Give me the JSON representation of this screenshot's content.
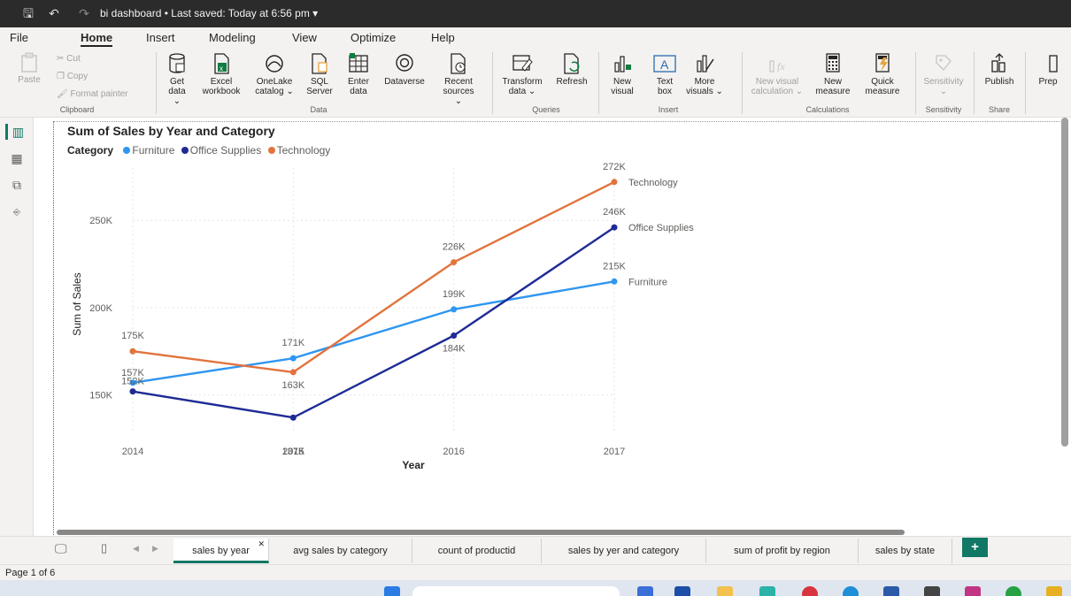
{
  "window": {
    "title": "bi dashboard",
    "saved": "Last saved: Today at 6:56 pm"
  },
  "menu": [
    "File",
    "Home",
    "Insert",
    "Modeling",
    "View",
    "Optimize",
    "Help"
  ],
  "ribbon": {
    "clipboard": {
      "paste": "Paste",
      "cut": "Cut",
      "copy": "Copy",
      "format_painter": "Format painter",
      "label": "Clipboard"
    },
    "data": {
      "get_data_1": "Get",
      "get_data_2": "data ⌄",
      "excel_1": "Excel",
      "excel_2": "workbook",
      "onelake_1": "OneLake",
      "onelake_2": "catalog ⌄",
      "sql_1": "SQL",
      "sql_2": "Server",
      "enter_1": "Enter",
      "enter_2": "data",
      "dataverse": "Dataverse",
      "recent_1": "Recent",
      "recent_2": "sources ⌄",
      "label": "Data"
    },
    "queries": {
      "transform_1": "Transform",
      "transform_2": "data ⌄",
      "refresh": "Refresh",
      "label": "Queries"
    },
    "insert": {
      "new_visual_1": "New",
      "new_visual_2": "visual",
      "text_box_1": "Text",
      "text_box_2": "box",
      "more_1": "More",
      "more_2": "visuals ⌄",
      "label": "Insert"
    },
    "calculations": {
      "new_visual_calc_1": "New visual",
      "new_visual_calc_2": "calculation ⌄",
      "new_measure_1": "New",
      "new_measure_2": "measure",
      "quick_measure_1": "Quick",
      "quick_measure_2": "measure",
      "label": "Calculations"
    },
    "sensitivity": {
      "btn": "Sensitivity",
      "btn_2": "⌄",
      "label": "Sensitivity"
    },
    "share": {
      "publish": "Publish",
      "label": "Share"
    },
    "prep": "Prep"
  },
  "chart_data": {
    "type": "line",
    "title": "Sum of Sales by Year and Category",
    "legend_title": "Category",
    "legend_position": "top-left",
    "xlabel": "Year",
    "ylabel": "Sum of Sales",
    "categories": [
      "2014",
      "2015",
      "2016",
      "2017"
    ],
    "y_ticks": [
      "150K",
      "200K",
      "250K"
    ],
    "y_tick_values": [
      150000,
      200000,
      250000
    ],
    "ylim": [
      128000,
      280000
    ],
    "grid": true,
    "series": [
      {
        "name": "Furniture",
        "color": "#2f96f0",
        "values": [
          157000,
          171000,
          199000,
          215000
        ],
        "labels": [
          "157K",
          "171K",
          "199K",
          "215K"
        ]
      },
      {
        "name": "Office Supplies",
        "color": "#1f2b95",
        "values": [
          152000,
          137000,
          184000,
          246000
        ],
        "labels": [
          "152K",
          "137K",
          "184K",
          "246K"
        ]
      },
      {
        "name": "Technology",
        "color": "#e2733d",
        "values": [
          175000,
          163000,
          226000,
          272000
        ],
        "labels": [
          "175K",
          "163K",
          "226K",
          "272K"
        ]
      }
    ]
  },
  "pages": [
    "sales by year",
    "avg sales by category",
    "count of productid",
    "sales by yer and category",
    "sum of profit by region",
    "sales by state"
  ],
  "active_page": "sales by year",
  "add_page": "+",
  "status": {
    "page": "Page 1 of 6"
  }
}
